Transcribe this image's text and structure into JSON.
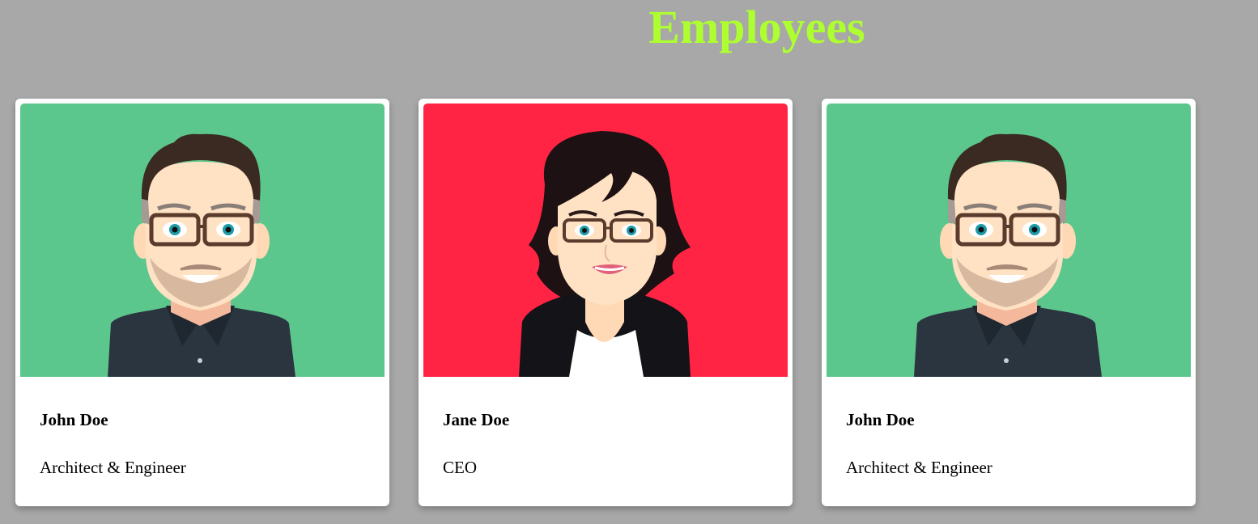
{
  "page": {
    "title": "Employees",
    "background": "#a8a8a8",
    "title_color": "#adff2f"
  },
  "employees": [
    {
      "name": "John Doe",
      "role": "Architect & Engineer",
      "avatar": "male-avatar-with-glasses",
      "avatar_bg": "#5cc78c"
    },
    {
      "name": "Jane Doe",
      "role": "CEO",
      "avatar": "female-avatar-with-glasses",
      "avatar_bg": "#ff2443"
    },
    {
      "name": "John Doe",
      "role": "Architect & Engineer",
      "avatar": "male-avatar-with-glasses",
      "avatar_bg": "#5cc78c"
    }
  ]
}
